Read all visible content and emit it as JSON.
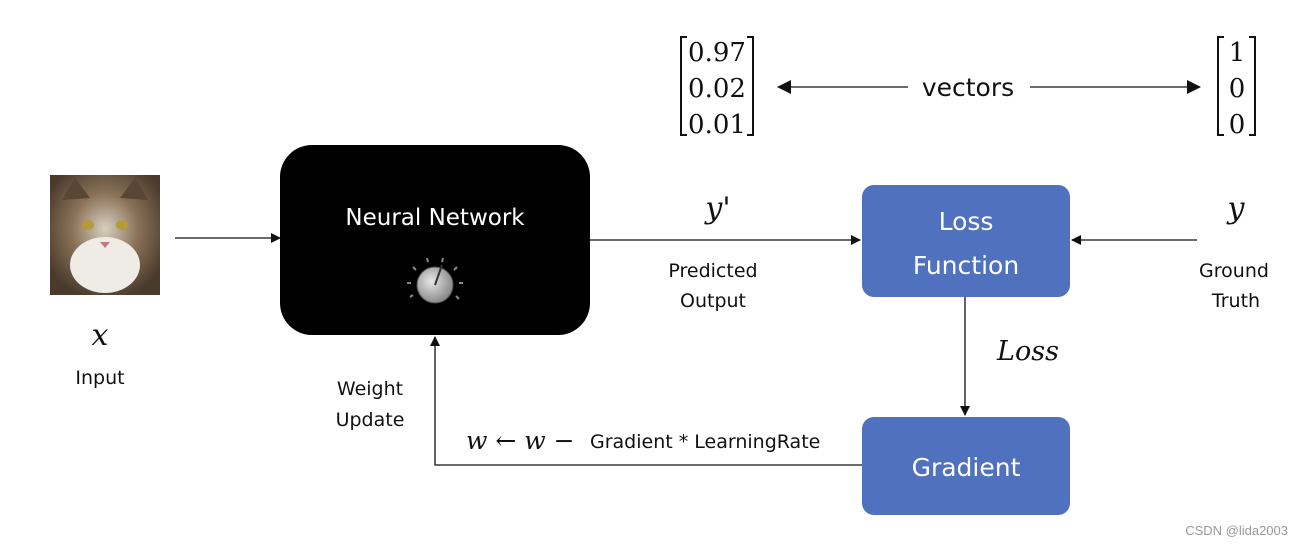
{
  "input": {
    "symbol": "x",
    "label": "Input",
    "image": "cat-photo"
  },
  "neural_network": {
    "label": "Neural Network",
    "icon": "knob-icon",
    "fill": "#000000"
  },
  "predicted": {
    "symbol": "y'",
    "label_line1": "Predicted",
    "label_line2": "Output"
  },
  "loss_function": {
    "line1": "Loss",
    "line2": "Function",
    "fill": "#4f71be"
  },
  "ground_truth": {
    "symbol": "y",
    "label_line1": "Ground",
    "label_line2": "Truth"
  },
  "loss_edge": {
    "label": "Loss"
  },
  "gradient": {
    "label": "Gradient",
    "fill": "#4f71be"
  },
  "update_rule": {
    "math": "w ← w −",
    "text": "Gradient * LearningRate"
  },
  "weight_update": {
    "line1": "Weight",
    "line2": "Update"
  },
  "vectors": {
    "label": "vectors",
    "predicted": [
      "0.97",
      "0.02",
      "0.01"
    ],
    "truth": [
      "1",
      "0",
      "0"
    ]
  },
  "watermark": "CSDN @lida2003"
}
